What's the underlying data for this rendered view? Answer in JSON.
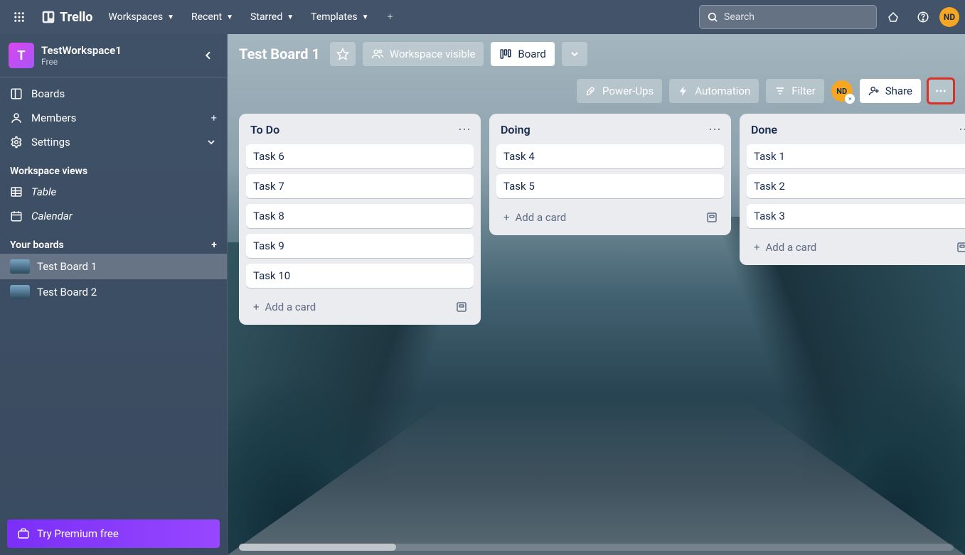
{
  "topnav": {
    "logo_text": "Trello",
    "menus": [
      "Workspaces",
      "Recent",
      "Starred",
      "Templates"
    ],
    "search_placeholder": "Search",
    "user_initials": "ND"
  },
  "sidebar": {
    "workspace_initial": "T",
    "workspace_name": "TestWorkspace1",
    "workspace_plan": "Free",
    "nav": {
      "boards": "Boards",
      "members": "Members",
      "settings": "Settings"
    },
    "views_heading": "Workspace views",
    "views": {
      "table": "Table",
      "calendar": "Calendar"
    },
    "your_boards_heading": "Your boards",
    "boards": [
      {
        "name": "Test Board 1",
        "active": true
      },
      {
        "name": "Test Board 2",
        "active": false
      }
    ],
    "premium_cta": "Try Premium free"
  },
  "board_header": {
    "title": "Test Board 1",
    "visibility": "Workspace visible",
    "view_label": "Board",
    "powerups": "Power-Ups",
    "automation": "Automation",
    "filter": "Filter",
    "share": "Share",
    "member_initials": "ND"
  },
  "lists": [
    {
      "title": "To Do",
      "cards": [
        "Task 6",
        "Task 7",
        "Task 8",
        "Task 9",
        "Task 10"
      ],
      "add_label": "Add a card"
    },
    {
      "title": "Doing",
      "cards": [
        "Task 4",
        "Task 5"
      ],
      "add_label": "Add a card"
    },
    {
      "title": "Done",
      "cards": [
        "Task 1",
        "Task 2",
        "Task 3"
      ],
      "add_label": "Add a card"
    }
  ]
}
